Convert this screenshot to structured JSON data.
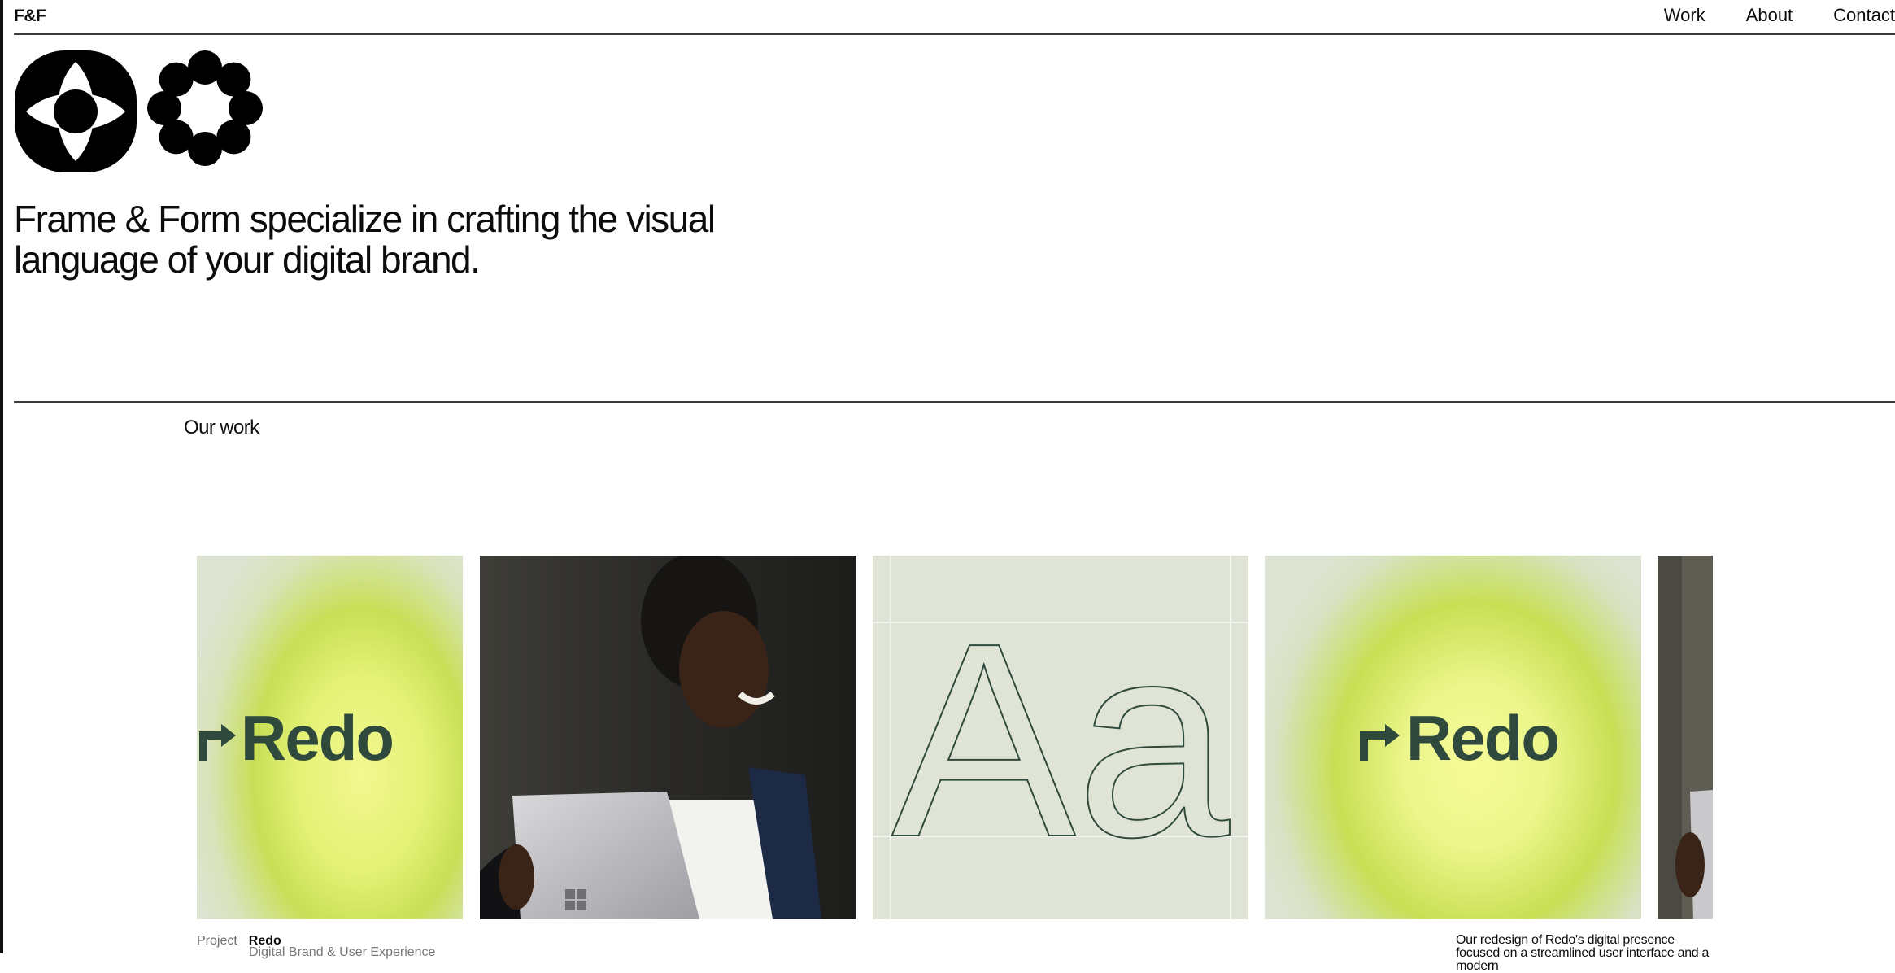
{
  "header": {
    "brand": "F&F",
    "nav": [
      "Work",
      "About",
      "Contact"
    ]
  },
  "hero": {
    "headline": "Frame & Form specialize in crafting the visual language of your digital brand."
  },
  "work": {
    "section_title": "Our work",
    "cards": [
      {
        "type": "logo",
        "text": "Redo",
        "icon": "redo-arrow-icon"
      },
      {
        "type": "photo",
        "subject": "man-with-tablet"
      },
      {
        "type": "typography",
        "text": "Aa"
      },
      {
        "type": "logo",
        "text": "Redo",
        "icon": "redo-arrow-icon"
      },
      {
        "type": "photo",
        "subject": "tablet-partial"
      }
    ],
    "project": {
      "label": "Project",
      "name": "Redo",
      "services": "Digital Brand & User Experience",
      "description": "Our redesign of Redo's digital presence focused on a streamlined user interface and a modern"
    }
  },
  "colors": {
    "accent_lime": "#e6f27a",
    "brand_green": "#2f4a3c",
    "sage": "#dfe4d6",
    "text": "#0c0c0c"
  }
}
